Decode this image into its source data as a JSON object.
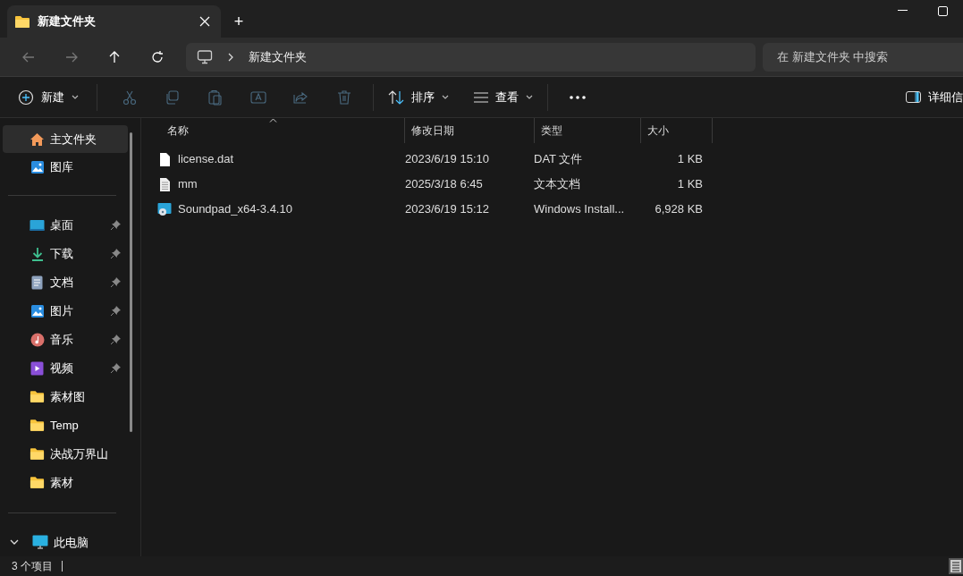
{
  "tabs": [
    {
      "title": "新建文件夹",
      "selected": true
    }
  ],
  "new_tab": "+",
  "breadcrumb": [
    "新建文件夹"
  ],
  "search": {
    "placeholder": "在 新建文件夹 中搜索"
  },
  "toolbar": {
    "new": "新建",
    "sort": "排序",
    "view": "查看",
    "details": "详细信"
  },
  "sidebar": {
    "top": [
      {
        "label": "主文件夹",
        "kind": "home",
        "selected": true
      },
      {
        "label": "图库",
        "kind": "gallery",
        "selected": false
      }
    ],
    "quick": [
      {
        "label": "桌面",
        "kind": "desktop",
        "pinned": true,
        "selected": false
      },
      {
        "label": "下载",
        "kind": "download",
        "pinned": true,
        "selected": false
      },
      {
        "label": "文档",
        "kind": "docs",
        "pinned": true,
        "selected": false
      },
      {
        "label": "图片",
        "kind": "pictures",
        "pinned": true,
        "selected": false
      },
      {
        "label": "音乐",
        "kind": "music",
        "pinned": true,
        "selected": false
      },
      {
        "label": "视频",
        "kind": "video",
        "pinned": true,
        "selected": false
      },
      {
        "label": "素材图",
        "kind": "folder",
        "pinned": false,
        "selected": false
      },
      {
        "label": "Temp",
        "kind": "folder",
        "pinned": false,
        "selected": false
      },
      {
        "label": "决战万界山",
        "kind": "folder",
        "pinned": false,
        "selected": false
      },
      {
        "label": "素材",
        "kind": "folder",
        "pinned": false,
        "selected": false
      }
    ],
    "this_pc": {
      "label": "此电脑",
      "expanded": true
    }
  },
  "table": {
    "columns": [
      "名称",
      "修改日期",
      "类型",
      "大小"
    ],
    "rows": [
      {
        "kind": "file",
        "name": "license.dat",
        "modified": "2023/6/19 15:10",
        "type": "DAT 文件",
        "size": "1 KB"
      },
      {
        "kind": "text",
        "name": "mm",
        "modified": "2025/3/18 6:45",
        "type": "文本文档",
        "size": "1 KB"
      },
      {
        "kind": "installer",
        "name": "Soundpad_x64-3.4.10",
        "modified": "2023/6/19 15:12",
        "type": "Windows Install...",
        "size": "6,928 KB"
      }
    ]
  },
  "status_bar": {
    "count": "3 个项目"
  }
}
